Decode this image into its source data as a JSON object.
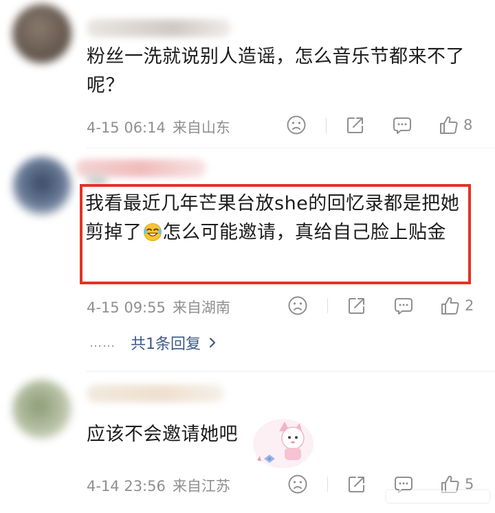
{
  "comments": [
    {
      "text": "粉丝一洗就说别人造谣，怎么音乐节都来不了呢？",
      "date": "4-15 06:14",
      "location": "来自山东",
      "likes": "8"
    },
    {
      "text_before_emoji": "我看最近几年芒果台放she的回忆录都是把她剪掉了",
      "emoji": "rofl-emoji",
      "text_after_emoji": "怎么可能邀请，真给自己脸上贴金",
      "date": "4-15 09:55",
      "location": "来自湖南",
      "likes": "2",
      "replies": {
        "dots": "……",
        "label": "共1条回复"
      }
    },
    {
      "text": "应该不会邀请她吧",
      "date": "4-14 23:56",
      "location": "来自江苏",
      "likes": "5"
    }
  ],
  "icons": {
    "reaction": "sad-face-icon",
    "share": "share-icon",
    "comment": "comment-bubble-icon",
    "like": "thumbs-up-icon",
    "replies": "chevron-right-icon"
  },
  "colors": {
    "highlight_box": "#e53222",
    "reply_link": "#3d5a8a",
    "meta_text": "#8f8f8f"
  }
}
